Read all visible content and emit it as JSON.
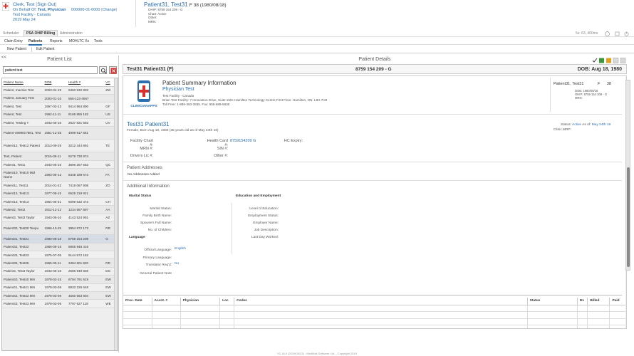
{
  "header": {
    "user_name": "Clerk, Test",
    "sign_out": "Sign Out",
    "on_behalf_label": "On Behalf Of:",
    "physician": "Test, Physician",
    "physician_id": "000000-01-0000",
    "change": "Change",
    "facility": "Test Facility - Canada",
    "date": "2019 May 24",
    "patient_name": "Patient31, Test31",
    "patient_sex_dob": "F 38 (1980/08/18)",
    "ohip_label": "OHIP:",
    "ohip_value": "8759 154 209 - G",
    "chart_label": "Chart:",
    "chart_value": "Active",
    "other_label": "Other:",
    "mrn_label": "MRN:",
    "session": "5s: 63, 400ms"
  },
  "tabs": [
    "Scheduler",
    "PSA OHIP Billing",
    "Administration"
  ],
  "subtabs": [
    "Claim Entry",
    "Patients",
    "Reports",
    "MOHLTC Xs",
    "Tools"
  ],
  "actions": [
    "New Patient",
    "Edit Patient"
  ],
  "patient_list": {
    "collapse": "<<",
    "title": "Patient List",
    "search_value": "patient test",
    "columns": [
      "Patient Name",
      "DOB",
      "Health #",
      "VC"
    ],
    "rows": [
      [
        "Patient, Inactive Test",
        "2003-04-19",
        "5360 932 833",
        "ZW"
      ],
      [
        "Patient, January Test",
        "2003-01-16",
        "555-123-4567",
        ""
      ],
      [
        "Patient, Test",
        "1967-02-13",
        "9414 964 890",
        "GF"
      ],
      [
        "Patient, Test",
        "1962-11-11",
        "8166 855 182",
        "US"
      ],
      [
        "Patient, Testing T",
        "1943-05-16",
        "2637 831 692",
        "UV"
      ],
      [
        "Patient-499991?881, Test",
        "1951-12-28",
        "4999 917 661",
        ""
      ],
      [
        "Patient12, Test12 Patient",
        "2013-09-29",
        "3212 444 891",
        "TE"
      ],
      [
        "Test, Patient",
        "2015-08-11",
        "9278 730 974",
        ""
      ],
      [
        "Patient1, Test1",
        "1943-05-16",
        "3696 257 553",
        "QC"
      ],
      [
        "Patient10, Test10 Mid Name",
        "1983-05-13",
        "8448 189 673",
        "FA"
      ],
      [
        "Patient11, Test11",
        "2014-01-22",
        "7419 067 908",
        "ZO"
      ],
      [
        "Patient13, Test13",
        "1977-08-15",
        "6625 219 921",
        ""
      ],
      [
        "Patient13, Test13",
        "1964-05-31",
        "6099 632 473",
        "CH"
      ],
      [
        "Patient2, Test2",
        "1912-12-12",
        "1234 567 897",
        "AA"
      ],
      [
        "Patient3, Test3 Taylor",
        "1943-05-16",
        "4143 524 991",
        "AZ"
      ],
      [
        "Patient30, Test30 Teepu",
        "1966-10-25",
        "3954 872 173",
        "RR"
      ],
      [
        "Patient31, Test31",
        "1980-08-18",
        "8759 154 209",
        "G"
      ],
      [
        "Patient32, Test32",
        "1966-08-18",
        "8865 948 416",
        ""
      ],
      [
        "Patient33, Test33",
        "1975-07-05",
        "9144 572 162",
        ""
      ],
      [
        "Patient35, Test35",
        "1965-05-11",
        "3494 601 820",
        "RR"
      ],
      [
        "Patient4, Test4 Taylor",
        "1943-05-16",
        "2586 949 836",
        "DG"
      ],
      [
        "Patient40, Test40 MN",
        "1978-02-15",
        "6794 791 919",
        "EW"
      ],
      [
        "Patient41, Test41 MN",
        "1978-03-09",
        "8933 226 648",
        "EW"
      ],
      [
        "Patient42, Test42 MN",
        "1978-03-09",
        "4550 563 904",
        "EW"
      ],
      [
        "Patient43, Test43 MN",
        "1978-03-09",
        "7797 627 119",
        "WE"
      ]
    ]
  },
  "details": {
    "title": "Patient Details",
    "bar_name": "Test31 Patient31 (F)",
    "bar_hcn": "8759 154 209 - G",
    "bar_dob": "DOB: Aug 18, 1980",
    "summary_title": "Patient Summary Information",
    "summary_physician": "Physician Test",
    "summary_facility": "Test Facility - Canada",
    "summary_address": "Brian Test Facility: 7 Innovation Drive, Suite 150c Hamilton Technology Centre First Floor. Hamilton, ON. L9H 7H9",
    "summary_phone": "Toll Free: 1-888-363-3835. Fax: 905-689-5936",
    "brand": "CLINICIANAPPS",
    "card_name": "Patient31, Test31",
    "card_sex": "F",
    "card_age": "38",
    "card_dob": "DOB: 1980/08/18",
    "card_ohip": "OHIP: 8759 154 209 - G",
    "card_mrn": "MRN:",
    "patient_heading": "Test31 Patient31",
    "patient_sub": "Female, Born Aug 18, 1980 (38 years old as of May 24th 19)",
    "status_label": "Status:",
    "status_value": "Active",
    "as_of_label": "As of:",
    "as_of_value": "May 24th 19",
    "clinic_mrp": "Clinic MRP:",
    "facility_chart": "Facility Chart #:",
    "health_card": "Health Card #:",
    "health_card_value": "8759154209 G",
    "hc_expiry": "HC Expiry:",
    "mrn": "MRN #:",
    "sin": "SIN #:",
    "drivers_lic": "Drivers Lic #:",
    "other": "Other #:",
    "addresses_heading": "Patient Addresses",
    "no_addresses": "No Addresses Added",
    "additional_heading": "Additional Information",
    "marital_heading": "Marital Status",
    "marital_fields": [
      "Marital Status:",
      "Family Birth Name:",
      "Spouse's Full Name:",
      "No. of Children:"
    ],
    "language_heading": "Language",
    "official_language": "Official Language:",
    "official_language_value": "English",
    "primary_language": "Primary Language:",
    "translator": "Translator Req'd:",
    "translator_value": "No",
    "general_note": "General Patient Note",
    "education_heading": "Education and Employment",
    "education_fields": [
      "Level of Education:",
      "Employment Status:",
      "Employer Name:",
      "Job Description:",
      "Last Day Worked:"
    ]
  },
  "encounters": {
    "columns": [
      "Proc. Date",
      "Accnt. #",
      "Physician",
      "Loc",
      "Codes",
      "Status",
      "Dx",
      "Billed",
      "Paid"
    ],
    "empty_rows": 10
  },
  "footer": "V2.16.0 (2019/05/23) - MedMail Software Ltd. - Copyright 2019"
}
